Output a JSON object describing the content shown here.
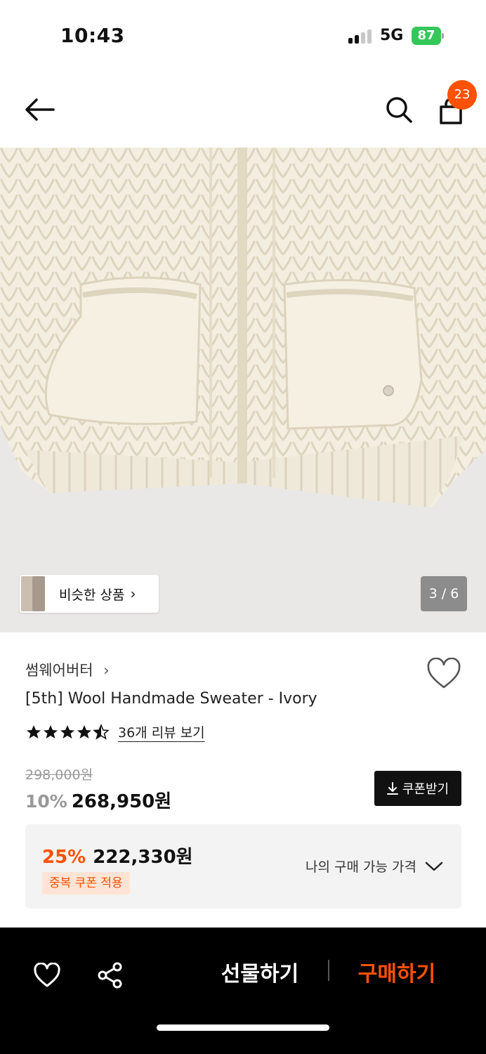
{
  "status_bar": {
    "time": "10:43",
    "network": "5G",
    "battery": "87"
  },
  "header": {
    "cart_count": "23"
  },
  "gallery": {
    "similar_label": "비슷한 상품",
    "page_indicator": "3 / 6"
  },
  "product": {
    "brand": "썸웨어버터",
    "title": "[5th] Wool Handmade Sweater - Ivory",
    "rating_value": 4.5,
    "reviews_label": "36개 리뷰 보기",
    "original_price": "298,000원",
    "discount_rate": "10%",
    "price": "268,950원",
    "coupon_label": "쿠폰받기"
  },
  "best_price": {
    "rate": "25%",
    "price": "222,330원",
    "tag": "중복 쿠폰 적용",
    "my_price_label": "나의 구매 가능 가격"
  },
  "bottom_bar": {
    "gift_label": "선물하기",
    "buy_label": "구매하기"
  },
  "colors": {
    "accent": "#ff5100",
    "battery": "#35c759",
    "hero_bg": "#e9e8e7",
    "sweater": "#f3eedf"
  },
  "icons": [
    "back-arrow-icon",
    "search-icon",
    "shopping-bag-icon",
    "heart-icon",
    "share-icon",
    "star-icon",
    "download-icon",
    "chevron-down-icon",
    "chevron-right-icon"
  ]
}
